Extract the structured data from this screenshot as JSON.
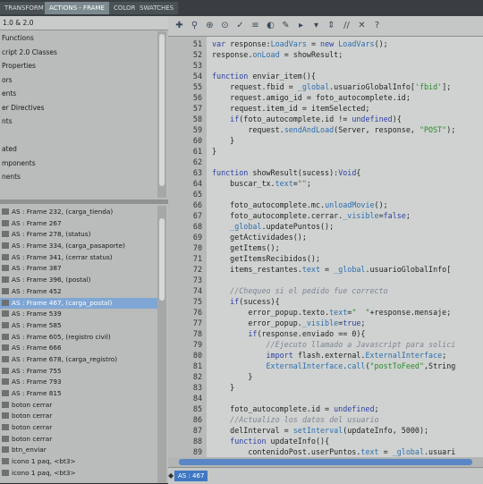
{
  "tabs": [
    "TRANSFORM",
    "ACTIONS - FRAME",
    "COLOR",
    "SWATCHES"
  ],
  "version_selector": "1.0 & 2.0",
  "tree_items": [
    "Functions",
    "cript 2.0 Classes",
    "Properties",
    "ors",
    "ents",
    "er Directives",
    "nts",
    "",
    "ated",
    "mponents",
    "nents"
  ],
  "frame_list": [
    {
      "label": "AS : Frame 232, (carga_tienda)",
      "selected": false
    },
    {
      "label": "AS : Frame 267",
      "selected": false
    },
    {
      "label": "AS : Frame 278, (status)",
      "selected": false
    },
    {
      "label": "AS : Frame 334, (carga_pasaporte)",
      "selected": false
    },
    {
      "label": "AS : Frame 341, (cerrar status)",
      "selected": false
    },
    {
      "label": "AS : Frame 387",
      "selected": false
    },
    {
      "label": "AS : Frame 396, (postal)",
      "selected": false
    },
    {
      "label": "AS : Frame 452",
      "selected": false
    },
    {
      "label": "AS : Frame 467, (carga_postal)",
      "selected": true
    },
    {
      "label": "AS : Frame 539",
      "selected": false
    },
    {
      "label": "AS : Frame 585",
      "selected": false
    },
    {
      "label": "AS : Frame 605, (registro civil)",
      "selected": false
    },
    {
      "label": "AS : Frame 666",
      "selected": false
    },
    {
      "label": "AS : Frame 678, (carga_registro)",
      "selected": false
    },
    {
      "label": "AS : Frame 755",
      "selected": false
    },
    {
      "label": "AS : Frame 793",
      "selected": false
    },
    {
      "label": "AS : Frame 815",
      "selected": false
    },
    {
      "label": "boton cerrar",
      "selected": false
    },
    {
      "label": "boton cerrar",
      "selected": false
    },
    {
      "label": "boton cerrar",
      "selected": false
    },
    {
      "label": "boton cerrar",
      "selected": false
    },
    {
      "label": "btn_enviar",
      "selected": false
    },
    {
      "label": "icono 1 paq, <bt3>",
      "selected": false
    },
    {
      "label": "icono 1 paq, <bt3>",
      "selected": false
    }
  ],
  "toolbar_icons": [
    "add-script-icon",
    "find-icon",
    "replace-icon",
    "target-icon",
    "check-syntax-icon",
    "auto-format-icon",
    "code-hint-icon",
    "debug-icon",
    "collapse-icon",
    "expand-icon",
    "collapse-all-icon",
    "comment-icon",
    "uncomment-icon",
    "help-icon"
  ],
  "code_lines": [
    {
      "num": "51",
      "text": "var response:LoadVars = new LoadVars();"
    },
    {
      "num": "52",
      "text": "response.onLoad = showResult;"
    },
    {
      "num": "53",
      "text": ""
    },
    {
      "num": "54",
      "text": "function enviar_item(){"
    },
    {
      "num": "55",
      "text": "    request.fbid = _global.usuarioGlobalInfo['fbid'];"
    },
    {
      "num": "56",
      "text": "    request.amigo_id = foto_autocomplete.id;"
    },
    {
      "num": "57",
      "text": "    request.item_id = itemSelected;"
    },
    {
      "num": "58",
      "text": "    if(foto_autocomplete.id != undefined){"
    },
    {
      "num": "59",
      "text": "        request.sendAndLoad(Server, response, \"POST\");"
    },
    {
      "num": "60",
      "text": "    }"
    },
    {
      "num": "61",
      "text": "}"
    },
    {
      "num": "62",
      "text": ""
    },
    {
      "num": "63",
      "text": "function showResult(sucess):Void{"
    },
    {
      "num": "64",
      "text": "    buscar_tx.text=\"\";"
    },
    {
      "num": "65",
      "text": ""
    },
    {
      "num": "66",
      "text": "    foto_autocomplete.mc.unloadMovie();"
    },
    {
      "num": "67",
      "text": "    foto_autocomplete.cerrar._visible=false;"
    },
    {
      "num": "68",
      "text": "    _global.updatePuntos();"
    },
    {
      "num": "69",
      "text": "    getActividades();"
    },
    {
      "num": "70",
      "text": "    getItems();"
    },
    {
      "num": "71",
      "text": "    getItemsRecibidos();"
    },
    {
      "num": "72",
      "text": "    items_restantes.text = _global.usuarioGlobalInfo["
    },
    {
      "num": "73",
      "text": ""
    },
    {
      "num": "74",
      "text": "    //Chequeo si el pedido fue correcto"
    },
    {
      "num": "75",
      "text": "    if(sucess){"
    },
    {
      "num": "76",
      "text": "        error_popup.texto.text=\"  \"+response.mensaje;"
    },
    {
      "num": "77",
      "text": "        error_popup._visible=true;"
    },
    {
      "num": "78",
      "text": "        if(response.enviado == 0){"
    },
    {
      "num": "79",
      "text": "            //Ejecuto llamado a Javascript para solici"
    },
    {
      "num": "80",
      "text": "            import flash.external.ExternalInterface;"
    },
    {
      "num": "81",
      "text": "            ExternalInterface.call(\"postToFeed\",String"
    },
    {
      "num": "82",
      "text": "        }"
    },
    {
      "num": "83",
      "text": "    }"
    },
    {
      "num": "84",
      "text": ""
    },
    {
      "num": "85",
      "text": "    foto_autocomplete.id = undefined;"
    },
    {
      "num": "86",
      "text": "    //Actualizo los datos del usuario"
    },
    {
      "num": "87",
      "text": "    delInterval = setInterval(updateInfo, 5000);"
    },
    {
      "num": "88",
      "text": "    function updateInfo(){"
    },
    {
      "num": "89",
      "text": "        contenidoPost.userPuntos.text = _global.usuari"
    }
  ],
  "status_tab": "AS : 467"
}
